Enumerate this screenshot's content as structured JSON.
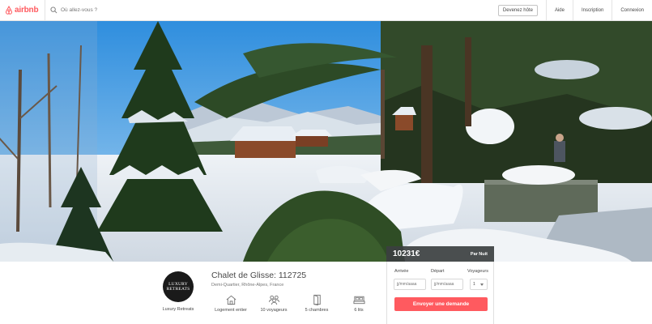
{
  "header": {
    "logo_text": "airbnb",
    "search_placeholder": "Où allez-vous ?",
    "host_button": "Devenez hôte",
    "nav": [
      "Aide",
      "Inscription",
      "Connexion"
    ]
  },
  "listing": {
    "price": "10231€",
    "price_unit": "Par Nuit",
    "title": "Chalet de Glisse: 112725",
    "location": "Demi-Quartier, Rhône-Alpes, France",
    "host_logo_line1": "LUXURY",
    "host_logo_line2": "RETREATS",
    "host_name": "Luxury Retreats",
    "features": [
      {
        "label": "Logement entier",
        "icon": "house-icon"
      },
      {
        "label": "10 voyageurs",
        "icon": "guests-icon"
      },
      {
        "label": "5 chambres",
        "icon": "door-icon"
      },
      {
        "label": "6 lits",
        "icon": "bed-icon"
      }
    ]
  },
  "booking": {
    "arrival_label": "Arrivée",
    "departure_label": "Départ",
    "guests_label": "Voyageurs",
    "arrival_placeholder": "jj/mm/aaaa",
    "departure_placeholder": "jj/mm/aaaa",
    "guests_value": "1",
    "submit_label": "Envoyer une demande"
  },
  "colors": {
    "brand": "#ff5a5f",
    "price_bar": "#3c3f40"
  }
}
